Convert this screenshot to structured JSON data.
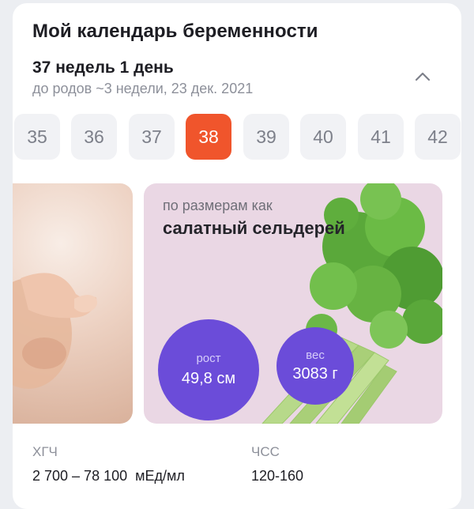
{
  "calendar": {
    "title": "Мой календарь беременности",
    "term": "37 недель 1 день",
    "due": "до родов ~3 недели, 23 дек. 2021",
    "collapse_icon": "chevron-up-icon"
  },
  "weeks": {
    "items": [
      "35",
      "36",
      "37",
      "38",
      "39",
      "40",
      "41",
      "42"
    ],
    "selected": "38",
    "active_color": "#f0552c"
  },
  "size": {
    "caption": "по размерам как",
    "name": "салатный сельдерей",
    "height_label": "рост",
    "height_value": "49,8 см",
    "weight_label": "вес",
    "weight_value": "3083 г",
    "bubble_color": "#6b4cd9",
    "card_color": "#ead7e4"
  },
  "metrics": {
    "hcg_label": "ХГЧ",
    "hcg_value": "2 700 – 78 100  мЕд/мл",
    "hr_label": "ЧСС",
    "hr_value": "120-160"
  }
}
